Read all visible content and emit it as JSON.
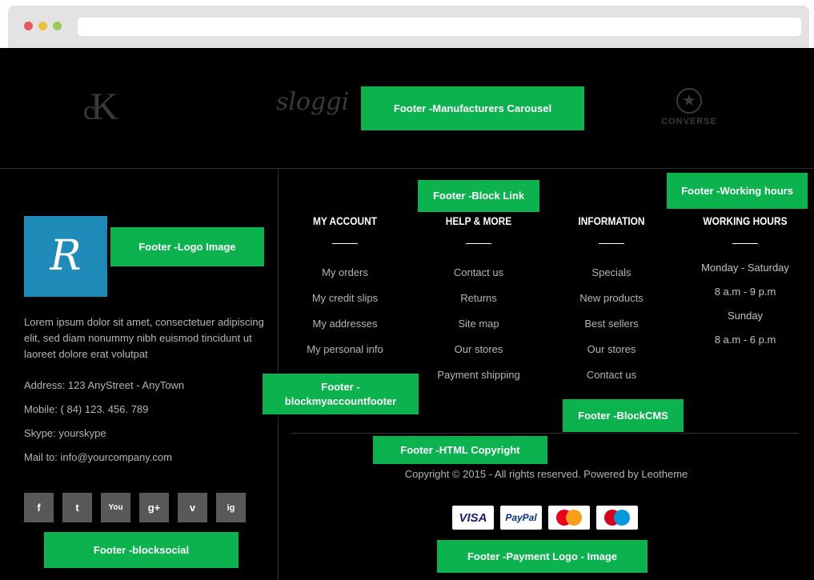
{
  "brands": {
    "ck_c": "c",
    "ck_k": "K",
    "sloggi": "sloggi",
    "converse_star": "★",
    "converse": "CONVERSE"
  },
  "logo": {
    "letter": "R",
    "bg": "#1f8bb8"
  },
  "about": "Lorem ipsum dolor sit amet, consectetuer adipiscing elit, sed diam nonummy nibh euismod tincidunt ut laoreet dolore erat volutpat",
  "contact": {
    "address": "Address: 123 AnyStreet - AnyTown",
    "mobile": "Mobile: ( 84) 123. 456. 789",
    "skype": "Skype: yourskype",
    "mail": "Mail to: info@yourcompany.com"
  },
  "social": [
    "f",
    "t",
    "You",
    "g+",
    "v",
    "ig"
  ],
  "columns": {
    "my_account": {
      "title": "MY ACCOUNT",
      "links": [
        "My orders",
        "My credit slips",
        "My addresses",
        "My personal info"
      ]
    },
    "help": {
      "title": "HELP & MORE",
      "links": [
        "Contact us",
        "Returns",
        "Site map",
        "Our stores",
        "Payment shipping"
      ]
    },
    "information": {
      "title": "INFORMATION",
      "links": [
        "Specials",
        "New products",
        "Best sellers",
        "Our stores",
        "Contact us"
      ]
    },
    "hours": {
      "title": "WORKING HOURS",
      "lines": [
        "Monday - Saturday",
        "8 a.m - 9 p.m",
        "Sunday",
        "8 a.m - 6 p.m"
      ]
    }
  },
  "copyright": "Copyright © 2015 - All rights reserved. Powered by Leotheme",
  "payments": {
    "visa": "VISA",
    "paypal": "PayPal"
  },
  "annotations": {
    "carousel": "Footer -Manufacturers Carousel",
    "block_link": "Footer -Block Link",
    "working_hours": "Footer -Working hours",
    "logo_image": "Footer -Logo Image",
    "myaccount_line1": "Footer -",
    "myaccount_line2": "blockmyaccountfooter",
    "blockcms": "Footer -BlockCMS",
    "html_copyright": "Footer -HTML Copyright",
    "blocksocial": "Footer -blocksocial",
    "payment_logo": "Footer -Payment Logo - Image"
  },
  "colors": {
    "annotation": "#0bb24d",
    "footer_bg": "#000000",
    "text": "#b5b5b5"
  }
}
